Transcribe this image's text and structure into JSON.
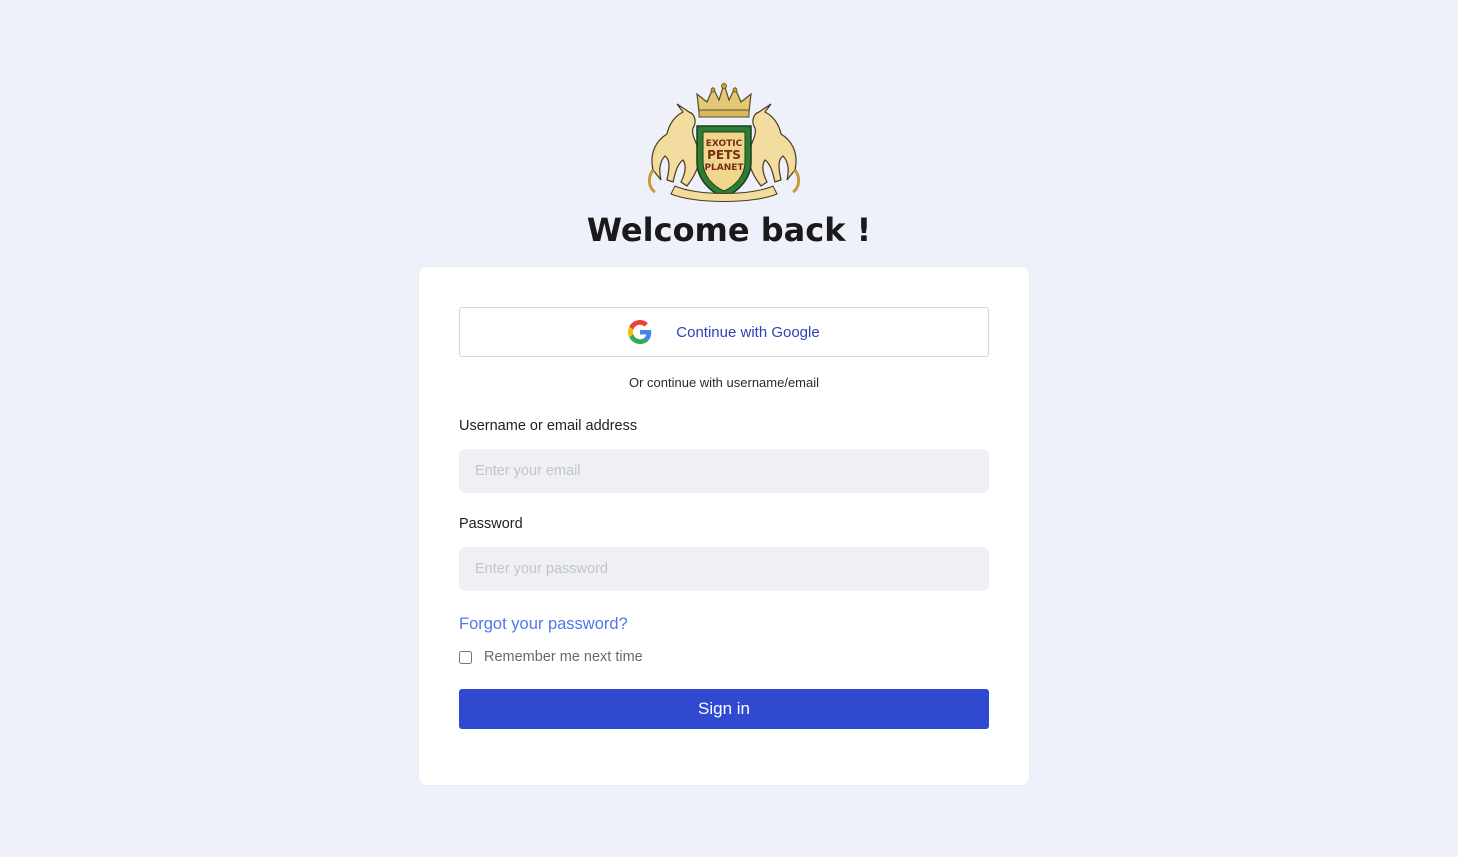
{
  "logo": {
    "name": "exotic-pets-planet-crest",
    "text_lines": [
      "EXOTIC",
      "PETS",
      "PLANET"
    ]
  },
  "header": {
    "welcome": "Welcome back !"
  },
  "google_button": {
    "label": "Continue with Google",
    "icon": "google-g-icon"
  },
  "divider": {
    "text": "Or continue with username/email"
  },
  "username_field": {
    "label": "Username or email address",
    "placeholder": "Enter your email",
    "value": ""
  },
  "password_field": {
    "label": "Password",
    "placeholder": "Enter your password",
    "value": ""
  },
  "forgot_password": {
    "label": "Forgot your password?"
  },
  "remember_me": {
    "label": "Remember me next time",
    "checked": false
  },
  "sign_in_button": {
    "label": "Sign in"
  },
  "colors": {
    "page_background": "#eef1f9",
    "card_background": "#ffffff",
    "primary_button": "#2f49d1",
    "link": "#4f78e8",
    "google_label": "#2d43b8",
    "input_background": "#eff0f4",
    "crest_green": "#2e7d32",
    "crest_gold": "#e8c96a"
  }
}
